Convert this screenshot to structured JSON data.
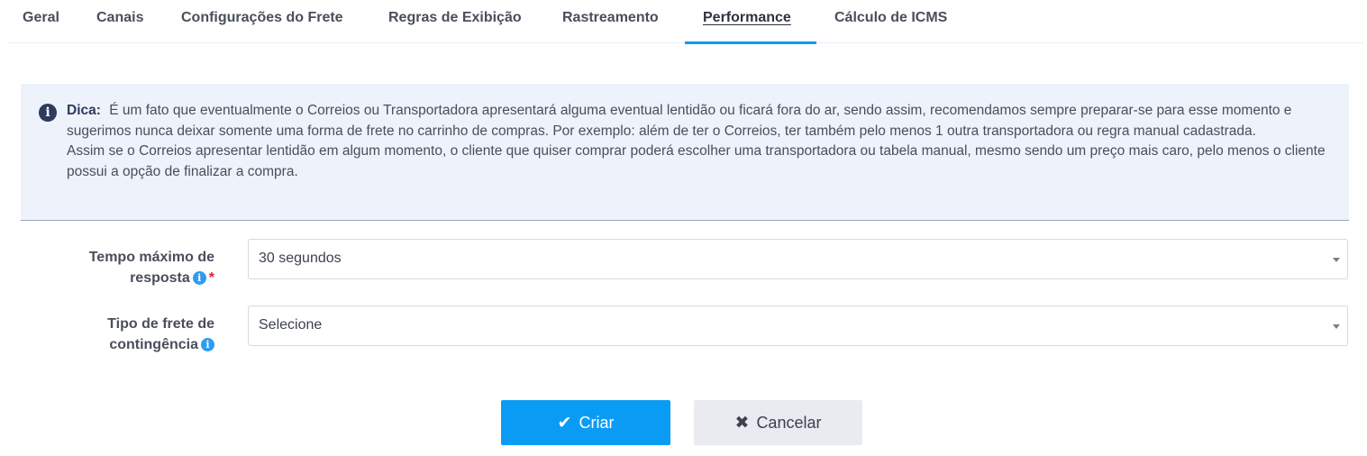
{
  "tabs": [
    {
      "label": "Geral",
      "active": false
    },
    {
      "label": "Canais",
      "active": false
    },
    {
      "label": "Configurações do Frete",
      "active": false
    },
    {
      "label": "Regras de Exibição",
      "active": false
    },
    {
      "label": "Rastreamento",
      "active": false
    },
    {
      "label": "Performance",
      "active": true
    },
    {
      "label": "Cálculo de ICMS",
      "active": false
    }
  ],
  "tip": {
    "icon": "info-circle-icon",
    "label": "Dica:",
    "paragraph1": "É um fato que eventualmente o Correios ou Transportadora apresentará alguma eventual lentidão ou ficará fora do ar, sendo assim, recomendamos sempre preparar-se para esse momento e sugerimos nunca deixar somente uma forma de frete no carrinho de compras. Por exemplo: além de ter o Correios, ter também pelo menos 1 outra transportadora ou regra manual cadastrada.",
    "paragraph2": "Assim se o Correios apresentar lentidão em algum momento, o cliente que quiser comprar poderá escolher uma transportadora ou tabela manual, mesmo sendo um preço mais caro, pelo menos o cliente possui a opção de finalizar a compra."
  },
  "form": {
    "max_response": {
      "label_line1": "Tempo máximo de",
      "label_line2": "resposta",
      "required_mark": "*",
      "value": "30 segundos"
    },
    "contingency": {
      "label_line1": "Tipo de frete de",
      "label_line2": "contingência",
      "value": "Selecione"
    }
  },
  "buttons": {
    "create": {
      "label": "Criar",
      "icon": "check-icon"
    },
    "cancel": {
      "label": "Cancelar",
      "icon": "x-icon"
    }
  },
  "colors": {
    "accent": "#0a9cf5",
    "tip_background": "#eef2fa",
    "required": "#e02424"
  }
}
